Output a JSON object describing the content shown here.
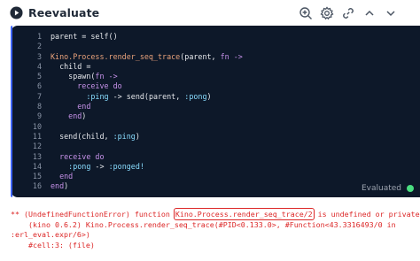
{
  "toolbar": {
    "run_label": "Reevaluate",
    "icons": [
      "zoom-icon",
      "gear-icon",
      "link-icon",
      "chevron-up-icon",
      "chevron-down-icon"
    ],
    "accent_color": "#3e64ff"
  },
  "editor": {
    "line_numbers": [
      "1",
      "2",
      "3",
      "4",
      "5",
      "6",
      "7",
      "8",
      "9",
      "10",
      "11",
      "12",
      "13",
      "14",
      "15",
      "16"
    ],
    "lines": [
      [
        "parent = self()"
      ],
      [
        ""
      ],
      [
        "Kino.Process.render_seq_trace(parent, fn ->"
      ],
      [
        "  child ="
      ],
      [
        "    spawn(fn ->"
      ],
      [
        "      receive do"
      ],
      [
        "        :ping -> send(parent, :pong)"
      ],
      [
        "      end"
      ],
      [
        "    end)"
      ],
      [
        ""
      ],
      [
        "  send(child, :ping)"
      ],
      [
        ""
      ],
      [
        "  receive do"
      ],
      [
        "    :pong -> :ponged!"
      ],
      [
        "  end"
      ],
      [
        "end)"
      ]
    ],
    "status_text": "Evaluated",
    "status_color": "#4ade80"
  },
  "error": {
    "prefix": "** (UndefinedFunctionError) function ",
    "function": "Kino.Process.render_seq_trace/2",
    "suffix": " is undefined or private",
    "line2": "    (kino 0.6.2) Kino.Process.render_seq_trace(#PID<0.133.0>, #Function<43.3316493/0 in",
    "line3": ":erl_eval.expr/6>)",
    "line4": "    #cell:3: (file)"
  }
}
